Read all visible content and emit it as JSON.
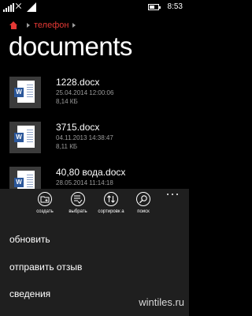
{
  "status_bar": {
    "time": "8:53",
    "battery_level": 0.5
  },
  "breadcrumb": {
    "items": [
      "телефон"
    ]
  },
  "page": {
    "title": "documents"
  },
  "files": [
    {
      "name": "1228.docx",
      "date": "25.04.2014 12:00:06",
      "size": "8,14 КБ"
    },
    {
      "name": "3715.docx",
      "date": "04.11.2013 14:38:47",
      "size": "8,11 КБ"
    },
    {
      "name": "40,80 вода.docx",
      "date": "28.05.2014 11:14:18",
      "size": ""
    }
  ],
  "app_bar": {
    "buttons": [
      {
        "label": "создать",
        "icon": "new-folder-icon"
      },
      {
        "label": "выбрать",
        "icon": "select-icon"
      },
      {
        "label": "сортировк а",
        "icon": "sort-icon"
      },
      {
        "label": "поиск",
        "icon": "search-icon"
      }
    ],
    "menu_items": [
      "обновить",
      "отправить отзыв",
      "сведения"
    ]
  },
  "watermark": "wintiles.ru",
  "colors": {
    "accent": "#e53935",
    "appbar_bg": "#1f1f1f",
    "word_blue": "#2b579a"
  }
}
